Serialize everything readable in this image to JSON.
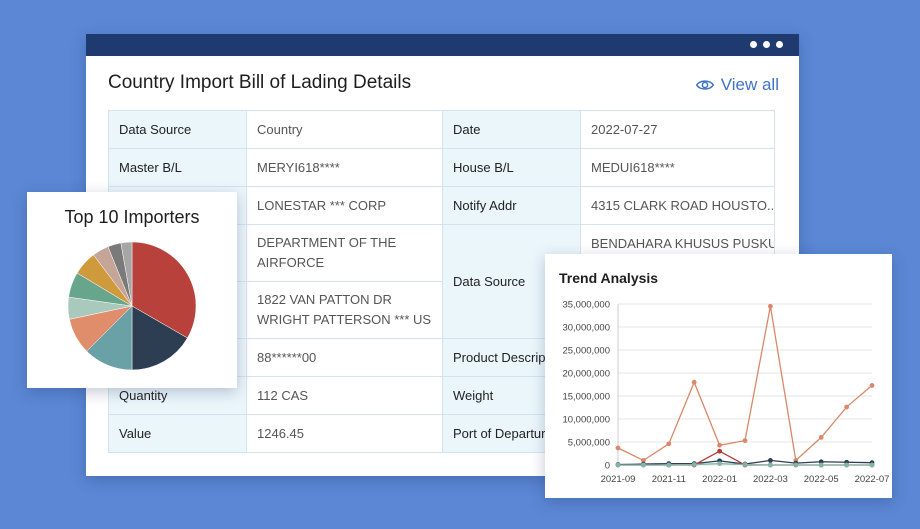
{
  "card": {
    "title": "Country Import Bill of Lading Details",
    "view_all": "View all"
  },
  "details": [
    {
      "label": "Data Source",
      "value": "Country",
      "label2": "Date",
      "value2": "2022-07-27"
    },
    {
      "label": "Master B/L",
      "value": "MERYI618****",
      "label2": "House B/L",
      "value2": "MEDUI618****"
    },
    {
      "label": "",
      "value": "LONESTAR *** CORP",
      "label2": "Notify Addr",
      "value2": "4315 CLARK ROAD HOUSTO..."
    },
    {
      "label": "",
      "value": "DEPARTMENT OF THE AIRFORCE",
      "label2": "Data Source",
      "value2": "BENDAHARA KHUSUS PUSKU"
    },
    {
      "label": "",
      "value": "1822 VAN PATTON DR WRIGHT PATTERSON  *** US"
    },
    {
      "label": "",
      "value": "88******00",
      "label2": "Product Descrip",
      "value2": ""
    },
    {
      "label": "Quantity",
      "value": "112 CAS",
      "label2": "Weight",
      "value2": ""
    },
    {
      "label": "Value",
      "value": "1246.45",
      "label2": "Port of Departur",
      "value2": ""
    }
  ],
  "pie": {
    "title": "Top 10 Importers",
    "slice_colors": [
      "#b8413b",
      "#2e3e52",
      "#6aa1a6",
      "#e08d6b",
      "#a8c9bb",
      "#67a58c",
      "#cf9a3c",
      "#c4a597",
      "#7a7a7a",
      "#a6a6a6"
    ]
  },
  "chart_data": {
    "type": "line",
    "title": "Trend Analysis",
    "x": [
      "2021-09",
      "2021-10",
      "2021-11",
      "2021-12",
      "2022-01",
      "2022-02",
      "2022-03",
      "2022-04",
      "2022-05",
      "2022-06",
      "2022-07"
    ],
    "x_tick_labels": [
      "2021-09",
      "2021-11",
      "2022-01",
      "2022-03",
      "2022-05",
      "2022-07"
    ],
    "y_tick_labels": [
      "0",
      "5,000,000",
      "10,000,000",
      "15,000,000",
      "20,000,000",
      "25,000,000",
      "30,000,000",
      "35,000,000"
    ],
    "ylim": [
      0,
      35000000
    ],
    "grid": true,
    "series": [
      {
        "color": "#d9886a",
        "values": [
          3700000,
          1000000,
          4600000,
          18000000,
          4300000,
          5300000,
          34500000,
          1000000,
          6000000,
          12600000,
          17300000
        ]
      },
      {
        "color": "#2b3f55",
        "values": [
          100000,
          200000,
          300000,
          300000,
          900000,
          200000,
          1000000,
          400000,
          700000,
          600000,
          500000
        ]
      },
      {
        "color": "#b83a35",
        "values": [
          0,
          0,
          0,
          0,
          3000000,
          0,
          0,
          0,
          0,
          0,
          0
        ]
      },
      {
        "color": "#7fb5a8",
        "values": [
          0,
          0,
          0,
          100000,
          300000,
          100000,
          0,
          0,
          0,
          0,
          0
        ]
      }
    ]
  }
}
